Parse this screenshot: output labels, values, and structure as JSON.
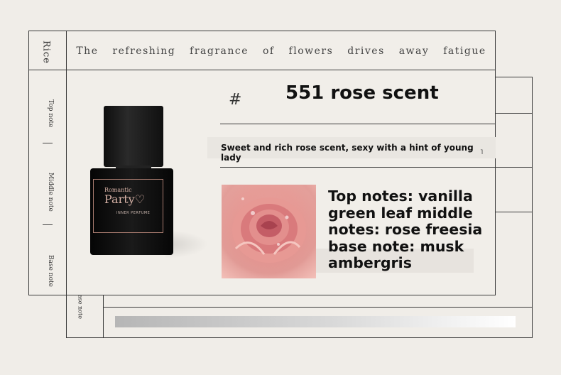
{
  "header": {
    "brand_vertical": "Rice",
    "tagline": "The refreshing fragrance of flowers drives away fatigue"
  },
  "sidebar": {
    "items": [
      {
        "label": "Top note"
      },
      {
        "label": "Middle note"
      },
      {
        "label": "Base note"
      }
    ],
    "back_label": "Base note"
  },
  "bottle": {
    "brand_small": "Romantic",
    "brand_big": "Party♡",
    "brand_sub": "INNER PERFUME"
  },
  "product": {
    "hash": "#",
    "title": "551 rose scent",
    "description": "Sweet and rich rose scent, sexy with a hint of young lady",
    "small_mark": "Ἱ",
    "notes": "Top notes: vanilla green leaf middle notes: rose freesia base note: musk ambergris"
  },
  "colors": {
    "background": "#f0ede8",
    "line": "#3a3a3a",
    "bottle_accent": "#d7b2a6"
  }
}
